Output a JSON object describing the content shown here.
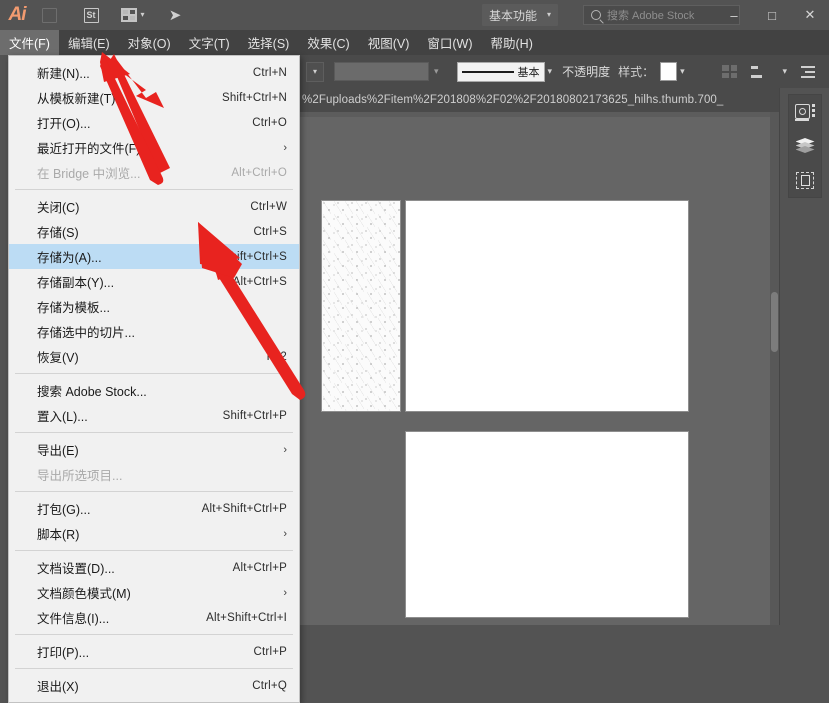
{
  "app": {
    "name": "Adobe Illustrator",
    "logo_text": "Ai"
  },
  "titlebar": {
    "icons": [
      {
        "name": "bridge-icon",
        "glyph": ""
      },
      {
        "name": "stock-icon",
        "glyph": "St"
      },
      {
        "name": "arrange-documents-icon",
        "glyph": ""
      },
      {
        "name": "share-icon",
        "glyph": "➤"
      }
    ],
    "workspace_label": "基本功能",
    "workspace_chevron": "⌄",
    "search_placeholder": "搜索 Adobe Stock",
    "window_controls": {
      "minimize": "–",
      "maximize": "□",
      "close": "✕"
    }
  },
  "menubar": {
    "items": [
      {
        "name": "menu-file",
        "label": "文件(F)",
        "active": true
      },
      {
        "name": "menu-edit",
        "label": "编辑(E)",
        "active": false
      },
      {
        "name": "menu-object",
        "label": "对象(O)",
        "active": false
      },
      {
        "name": "menu-type",
        "label": "文字(T)",
        "active": false
      },
      {
        "name": "menu-select",
        "label": "选择(S)",
        "active": false
      },
      {
        "name": "menu-effect",
        "label": "效果(C)",
        "active": false
      },
      {
        "name": "menu-view",
        "label": "视图(V)",
        "active": false
      },
      {
        "name": "menu-window",
        "label": "窗口(W)",
        "active": false
      },
      {
        "name": "menu-help",
        "label": "帮助(H)",
        "active": false
      }
    ]
  },
  "controlbar": {
    "stroke_preset": "基本",
    "opacity_label": "不透明度",
    "style_label": "样式：",
    "chevron": "⌄"
  },
  "document_tab": {
    "title": "%2Fuploads%2Fitem%2F201808%2F02%2F20180802173625_hilhs.thumb.700_"
  },
  "file_menu": {
    "groups": [
      [
        {
          "name": "menu-new",
          "label": "新建(N)...",
          "shortcut": "Ctrl+N",
          "disabled": false,
          "submenu": false,
          "highlight": false
        },
        {
          "name": "menu-new-from-template",
          "label": "从模板新建(T)...",
          "shortcut": "Shift+Ctrl+N",
          "disabled": false,
          "submenu": false,
          "highlight": false
        },
        {
          "name": "menu-open",
          "label": "打开(O)...",
          "shortcut": "Ctrl+O",
          "disabled": false,
          "submenu": false,
          "highlight": false
        },
        {
          "name": "menu-open-recent",
          "label": "最近打开的文件(F)",
          "shortcut": "",
          "disabled": false,
          "submenu": true,
          "highlight": false
        },
        {
          "name": "menu-browse-in-bridge",
          "label": "在 Bridge 中浏览...",
          "shortcut": "Alt+Ctrl+O",
          "disabled": true,
          "submenu": false,
          "highlight": false
        }
      ],
      [
        {
          "name": "menu-close",
          "label": "关闭(C)",
          "shortcut": "Ctrl+W",
          "disabled": false,
          "submenu": false,
          "highlight": false
        },
        {
          "name": "menu-save",
          "label": "存储(S)",
          "shortcut": "Ctrl+S",
          "disabled": false,
          "submenu": false,
          "highlight": false
        },
        {
          "name": "menu-save-as",
          "label": "存储为(A)...",
          "shortcut": "Shift+Ctrl+S",
          "disabled": false,
          "submenu": false,
          "highlight": true
        },
        {
          "name": "menu-save-a-copy",
          "label": "存储副本(Y)...",
          "shortcut": "Alt+Ctrl+S",
          "disabled": false,
          "submenu": false,
          "highlight": false
        },
        {
          "name": "menu-save-as-template",
          "label": "存储为模板...",
          "shortcut": "",
          "disabled": false,
          "submenu": false,
          "highlight": false
        },
        {
          "name": "menu-save-selected-slices",
          "label": "存储选中的切片...",
          "shortcut": "",
          "disabled": false,
          "submenu": false,
          "highlight": false
        },
        {
          "name": "menu-revert",
          "label": "恢复(V)",
          "shortcut": "F12",
          "disabled": false,
          "submenu": false,
          "highlight": false
        }
      ],
      [
        {
          "name": "menu-search-adobe-stock",
          "label": "搜索 Adobe Stock...",
          "shortcut": "",
          "disabled": false,
          "submenu": false,
          "highlight": false
        },
        {
          "name": "menu-place",
          "label": "置入(L)...",
          "shortcut": "Shift+Ctrl+P",
          "disabled": false,
          "submenu": false,
          "highlight": false
        }
      ],
      [
        {
          "name": "menu-export",
          "label": "导出(E)",
          "shortcut": "",
          "disabled": false,
          "submenu": true,
          "highlight": false
        },
        {
          "name": "menu-export-selection",
          "label": "导出所选项目...",
          "shortcut": "",
          "disabled": true,
          "submenu": false,
          "highlight": false
        }
      ],
      [
        {
          "name": "menu-package",
          "label": "打包(G)...",
          "shortcut": "Alt+Shift+Ctrl+P",
          "disabled": false,
          "submenu": false,
          "highlight": false
        },
        {
          "name": "menu-scripts",
          "label": "脚本(R)",
          "shortcut": "",
          "disabled": false,
          "submenu": true,
          "highlight": false
        }
      ],
      [
        {
          "name": "menu-document-setup",
          "label": "文档设置(D)...",
          "shortcut": "Alt+Ctrl+P",
          "disabled": false,
          "submenu": false,
          "highlight": false
        },
        {
          "name": "menu-document-color-mode",
          "label": "文档颜色模式(M)",
          "shortcut": "",
          "disabled": false,
          "submenu": true,
          "highlight": false
        },
        {
          "name": "menu-file-info",
          "label": "文件信息(I)...",
          "shortcut": "Alt+Shift+Ctrl+I",
          "disabled": false,
          "submenu": false,
          "highlight": false
        }
      ],
      [
        {
          "name": "menu-print",
          "label": "打印(P)...",
          "shortcut": "Ctrl+P",
          "disabled": false,
          "submenu": false,
          "highlight": false
        }
      ],
      [
        {
          "name": "menu-exit",
          "label": "退出(X)",
          "shortcut": "Ctrl+Q",
          "disabled": false,
          "submenu": false,
          "highlight": false
        }
      ]
    ],
    "submenu_glyph": "›"
  },
  "right_dock": {
    "panels": [
      {
        "name": "properties-panel-icon",
        "label": "属性"
      },
      {
        "name": "layers-panel-icon",
        "label": "图层"
      },
      {
        "name": "artboards-panel-icon",
        "label": "画板"
      }
    ]
  },
  "annotations": {
    "arrow_color": "#e8231f",
    "arrows": [
      {
        "name": "arrow-pointing-to-new",
        "target": "menu-new"
      },
      {
        "name": "arrow-pointing-to-save-as",
        "target": "menu-save-as"
      }
    ]
  }
}
